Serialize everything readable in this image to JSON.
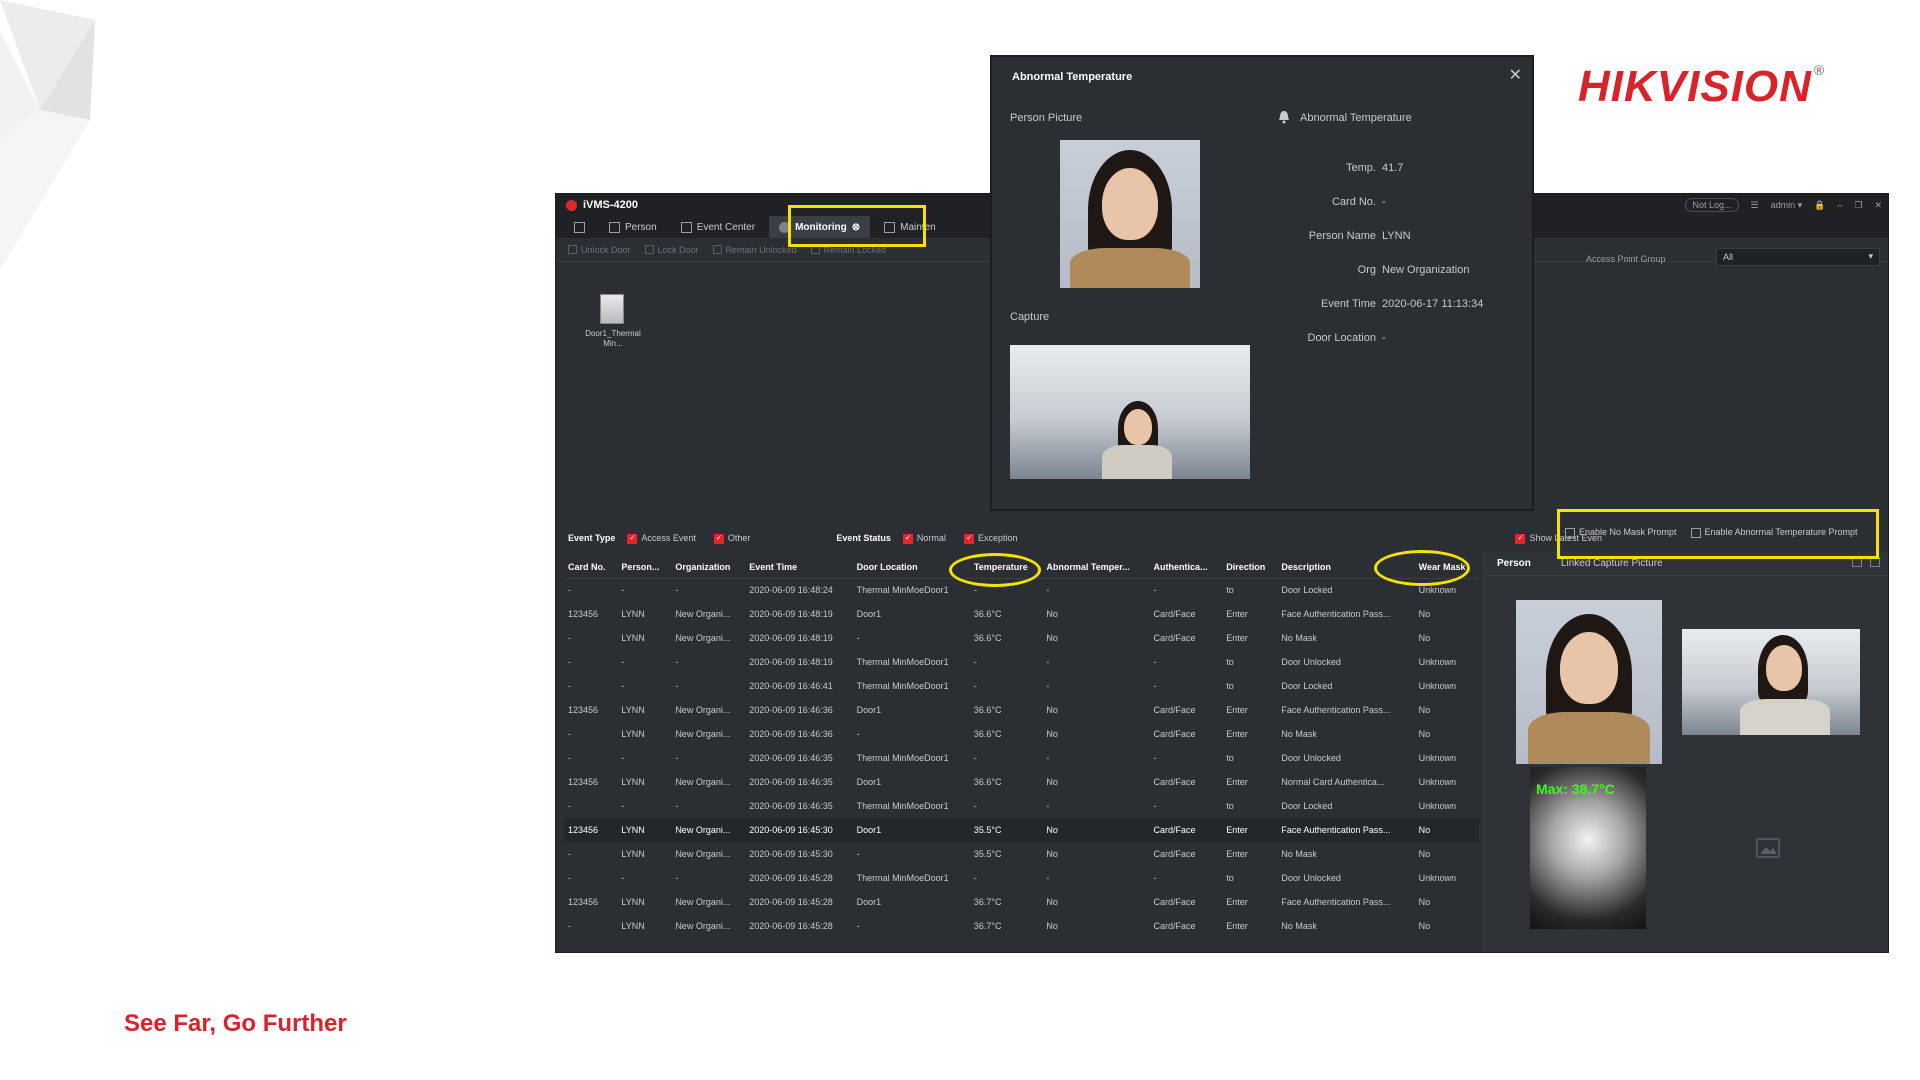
{
  "brand": {
    "logo_text": "HIKVISION",
    "tagline": "See Far, Go Further",
    "brand_color": "#d8232a"
  },
  "app": {
    "title": "iVMS-4200",
    "status_pill": "Not Log...",
    "user": "admin",
    "nav": [
      "Person",
      "Event Center",
      "Monitoring",
      "Mainten"
    ],
    "toolbar": [
      "Unlock Door",
      "Lock Door",
      "Remain Unlocked",
      "Remain Locked"
    ],
    "access_point_group_label": "Access Point Group",
    "access_point_group_value": "All",
    "door": {
      "label": "Door1_Thermal Min..."
    }
  },
  "filters": {
    "event_type_label": "Event Type",
    "event_type_options": [
      "Access Event",
      "Other"
    ],
    "event_status_label": "Event Status",
    "event_status_options": [
      "Normal",
      "Exception"
    ],
    "show_latest": "Show Latest Even",
    "enable_no_mask": "Enable No Mask Prompt",
    "enable_abnormal_temp": "Enable Abnormal Temperature Prompt"
  },
  "table": {
    "columns": [
      "Card No.",
      "Person...",
      "Organization",
      "Event Time",
      "Door Location",
      "Temperature",
      "Abnormal Temper...",
      "Authentica...",
      "Direction",
      "Description",
      "Wear Mask"
    ],
    "rows": [
      [
        "-",
        "-",
        "-",
        "2020-06-09 16:48:24",
        "Thermal MinMoeDoor1",
        "-",
        "-",
        "-",
        "to",
        "Door Locked",
        "Unknown"
      ],
      [
        "123456",
        "LYNN",
        "New Organi...",
        "2020-06-09 16:48:19",
        "Door1",
        "36.6°C",
        "No",
        "Card/Face",
        "Enter",
        "Face Authentication Pass...",
        "No"
      ],
      [
        "-",
        "LYNN",
        "New Organi...",
        "2020-06-09 16:48:19",
        "-",
        "36.6°C",
        "No",
        "Card/Face",
        "Enter",
        "No Mask",
        "No"
      ],
      [
        "-",
        "-",
        "-",
        "2020-06-09 16:48:19",
        "Thermal MinMoeDoor1",
        "-",
        "-",
        "-",
        "to",
        "Door Unlocked",
        "Unknown"
      ],
      [
        "-",
        "-",
        "-",
        "2020-06-09 16:46:41",
        "Thermal MinMoeDoor1",
        "-",
        "-",
        "-",
        "to",
        "Door Locked",
        "Unknown"
      ],
      [
        "123456",
        "LYNN",
        "New Organi...",
        "2020-06-09 16:46:36",
        "Door1",
        "36.6°C",
        "No",
        "Card/Face",
        "Enter",
        "Face Authentication Pass...",
        "No"
      ],
      [
        "-",
        "LYNN",
        "New Organi...",
        "2020-06-09 16:46:36",
        "-",
        "36.6°C",
        "No",
        "Card/Face",
        "Enter",
        "No Mask",
        "No"
      ],
      [
        "-",
        "-",
        "-",
        "2020-06-09 16:46:35",
        "Thermal MinMoeDoor1",
        "-",
        "-",
        "-",
        "to",
        "Door Unlocked",
        "Unknown"
      ],
      [
        "123456",
        "LYNN",
        "New Organi...",
        "2020-06-09 16:46:35",
        "Door1",
        "36.6°C",
        "No",
        "Card/Face",
        "Enter",
        "Normal Card Authentica...",
        "Unknown"
      ],
      [
        "-",
        "-",
        "-",
        "2020-06-09 16:46:35",
        "Thermal MinMoeDoor1",
        "-",
        "-",
        "-",
        "to",
        "Door Locked",
        "Unknown"
      ],
      [
        "123456",
        "LYNN",
        "New Organi...",
        "2020-06-09 16:45:30",
        "Door1",
        "35.5°C",
        "No",
        "Card/Face",
        "Enter",
        "Face Authentication Pass...",
        "No"
      ],
      [
        "-",
        "LYNN",
        "New Organi...",
        "2020-06-09 16:45:30",
        "-",
        "35.5°C",
        "No",
        "Card/Face",
        "Enter",
        "No Mask",
        "No"
      ],
      [
        "-",
        "-",
        "-",
        "2020-06-09 16:45:28",
        "Thermal MinMoeDoor1",
        "-",
        "-",
        "-",
        "to",
        "Door Unlocked",
        "Unknown"
      ],
      [
        "123456",
        "LYNN",
        "New Organi...",
        "2020-06-09 16:45:28",
        "Door1",
        "36.7°C",
        "No",
        "Card/Face",
        "Enter",
        "Face Authentication Pass...",
        "No"
      ],
      [
        "-",
        "LYNN",
        "New Organi...",
        "2020-06-09 16:45:28",
        "-",
        "36.7°C",
        "No",
        "Card/Face",
        "Enter",
        "No Mask",
        "No"
      ]
    ],
    "selected_row": 10
  },
  "side_panel": {
    "tab_person": "Person",
    "tab_linked": "Linked Capture Picture",
    "thermal_temp": "Max: 38.7°C"
  },
  "modal": {
    "title": "Abnormal Temperature",
    "person_picture_label": "Person Picture",
    "capture_label": "Capture",
    "alert_label": "Abnormal Temperature",
    "fields": [
      {
        "k": "Temp.",
        "v": "41.7"
      },
      {
        "k": "Card No.",
        "v": "-"
      },
      {
        "k": "Person Name",
        "v": "LYNN"
      },
      {
        "k": "Org",
        "v": "New Organization"
      },
      {
        "k": "Event Time",
        "v": "2020-06-17 11:13:34"
      },
      {
        "k": "Door Location",
        "v": "-"
      }
    ]
  },
  "colors": {
    "highlight": "#f4e300",
    "app_bg": "#2b2e33",
    "accent_red": "#e0282b"
  }
}
